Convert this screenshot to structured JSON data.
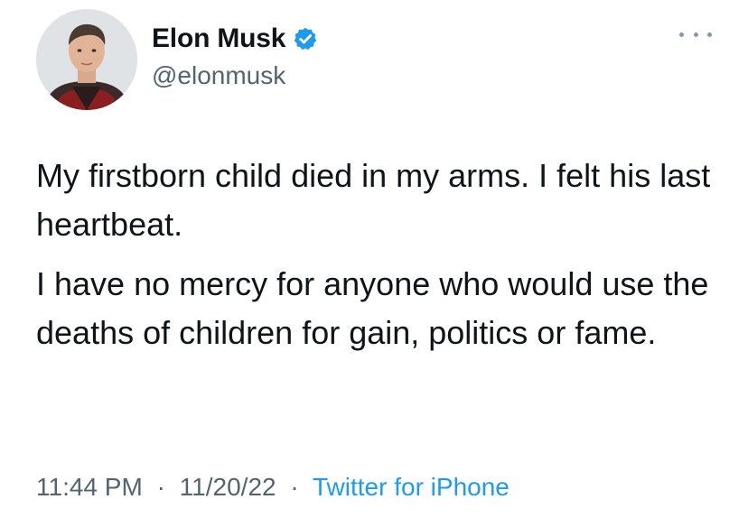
{
  "author": {
    "name": "Elon Musk",
    "handle": "@elonmusk",
    "verified": true,
    "verified_color": "#1d9bf0"
  },
  "tweet": {
    "paragraphs": [
      "My firstborn child died in my arms. I felt his last heartbeat.",
      "I have no mercy for anyone who would use the deaths of children for gain, politics or fame."
    ]
  },
  "meta": {
    "time": "11:44 PM",
    "date": "11/20/22",
    "separator": "·",
    "source": "Twitter for iPhone",
    "source_color": "#1d9bf0"
  },
  "icons": {
    "verified": "verified-badge-icon",
    "more": "more-options-icon"
  }
}
